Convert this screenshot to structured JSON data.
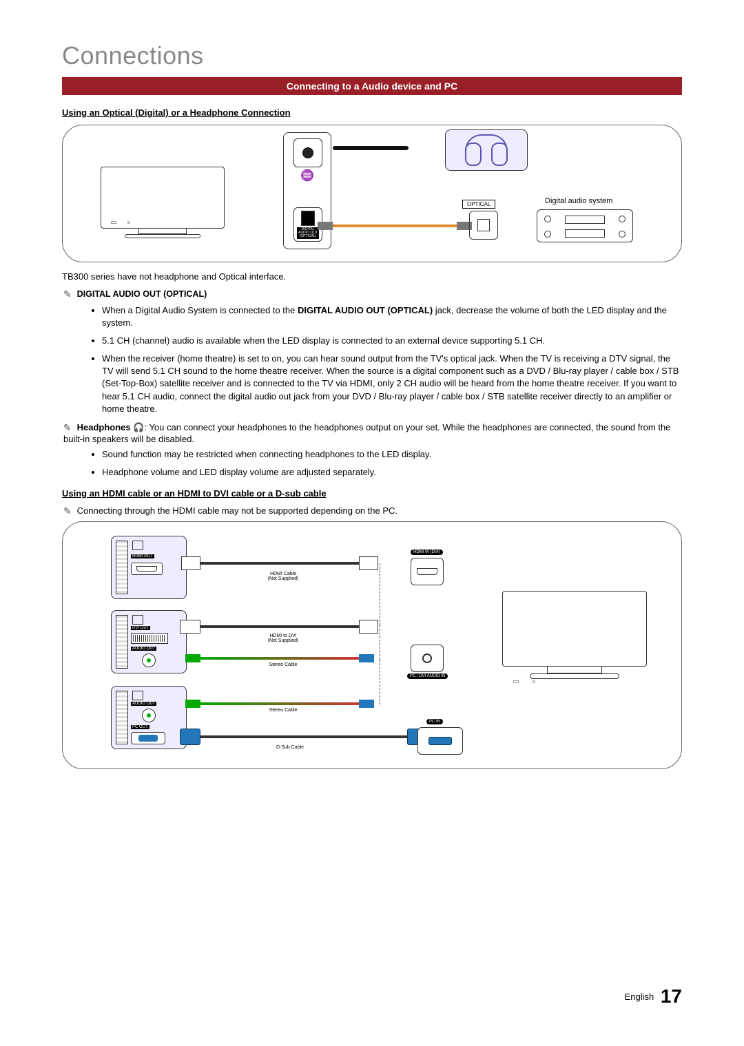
{
  "chapter_title": "Connections",
  "section_bar": "Connecting to a Audio device and PC",
  "subhead1": "Using an Optical (Digital) or a Headphone Connection",
  "diagram1": {
    "optical_label": "OPTICAL",
    "digital_audio_out_label": "DIGITAL AUDIO OUT (OPTICAL)",
    "das_label": "Digital audio system"
  },
  "tb300_note": "TB300 series have not headphone and Optical interface.",
  "note_icon": "✎",
  "digital_out_heading": "DIGITAL AUDIO OUT (OPTICAL)",
  "digital_out_bullets": [
    {
      "pre": "When a Digital Audio System is connected to the ",
      "bold": "DIGITAL AUDIO OUT (OPTICAL)",
      "post": " jack, decrease the volume of both the LED display and the system."
    },
    {
      "text": "5.1 CH (channel) audio is available when the LED display is connected to an external device supporting 5.1 CH."
    },
    {
      "text": "When the receiver (home theatre) is set to on, you can hear sound output from the TV's optical jack. When the TV is receiving a DTV signal, the TV will send 5.1 CH sound to the home theatre receiver. When the source is a digital component such as a DVD / Blu-ray player / cable box / STB (Set-Top-Box) satellite receiver and is connected to the TV via HDMI, only 2 CH audio will be heard from the home theatre receiver. If you want to hear 5.1 CH audio, connect the digital audio out jack from your DVD / Blu-ray player / cable box / STB satellite receiver directly to an amplifier or home theatre."
    }
  ],
  "headphones_label": "Headphones",
  "headphones_symbol": "🎧",
  "headphones_text": ": You can connect your headphones to the headphones output on your set. While the headphones are connected, the sound from the built-in speakers will be disabled.",
  "headphones_bullets": [
    "Sound function may be restricted when connecting headphones to the LED display.",
    "Headphone volume and LED display volume are adjusted separately."
  ],
  "subhead2": "Using an HDMI cable or an HDMI to DVI cable or a D-sub cable",
  "hdmi_pc_note": "Connecting through the HDMI cable may not be supported depending on the PC.",
  "diagram2": {
    "pc1": {
      "out": "HDMI OUT"
    },
    "pc2": {
      "out": "DVI OUT",
      "audio": "AUDIO OUT"
    },
    "pc3": {
      "audio": "AUDIO OUT",
      "pc": "PC OUT"
    },
    "cable_hdmi": "HDMI Cable",
    "cable_hdmi_sub": "(Not Supplied)",
    "cable_hdmi_dvi": "HDMI to DVI",
    "cable_hdmi_dvi_sub": "(Not Supplied)",
    "cable_stereo": "Stereo Cable",
    "cable_dsub": "D-Sub Cable",
    "tv_hdmi": "HDMI IN (DVI)",
    "tv_audio": "PC / DVI AUDIO IN",
    "tv_pc": "PC IN"
  },
  "footer_lang": "English",
  "footer_page": "17"
}
